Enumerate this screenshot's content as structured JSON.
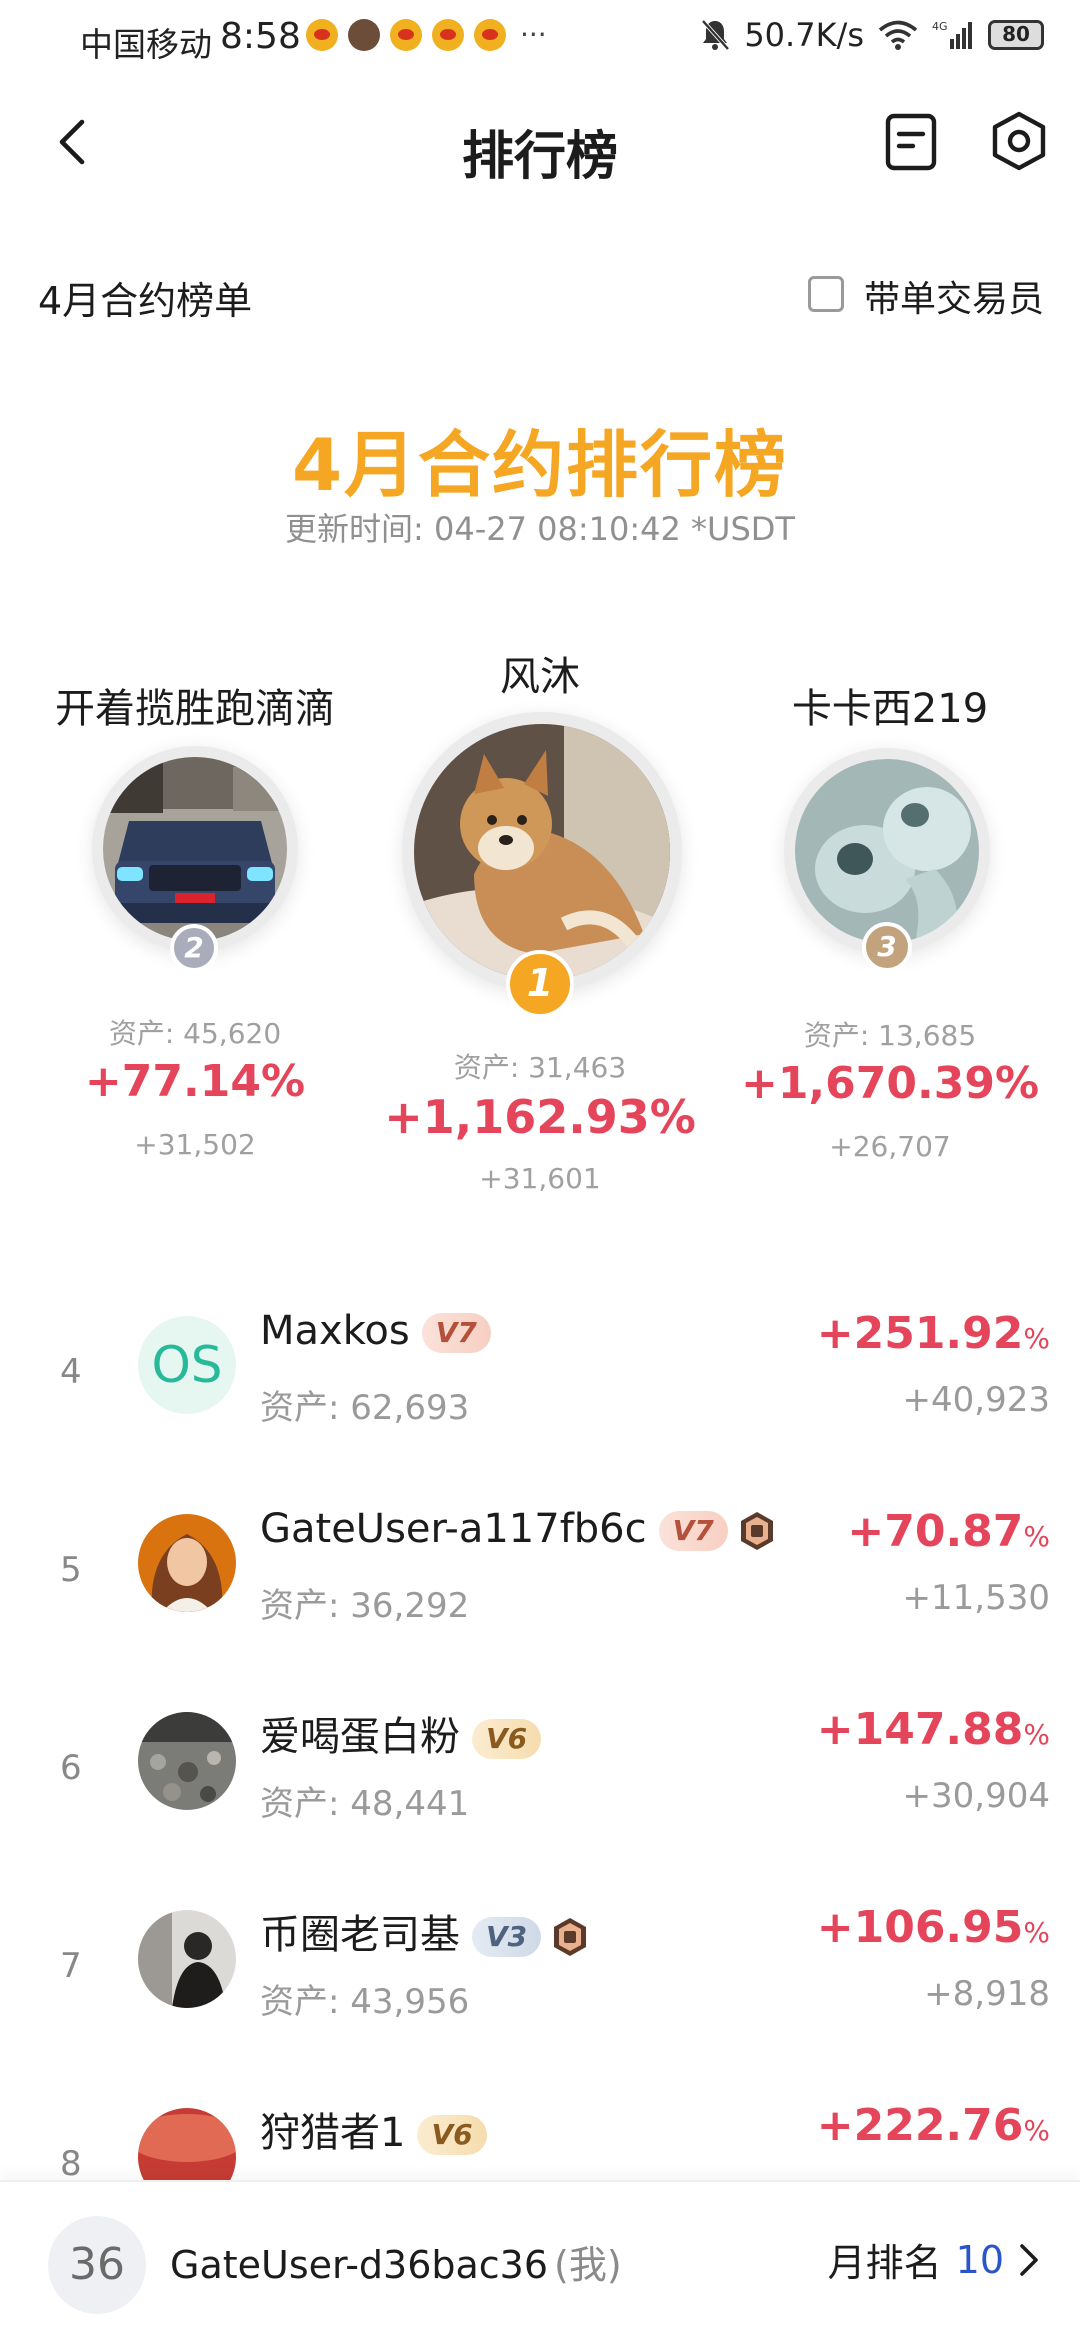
{
  "status_bar": {
    "carrier": "中国移动",
    "time": "8:58",
    "more": "···",
    "net_speed": "50.7K/s",
    "network": "4G",
    "battery": "80"
  },
  "header": {
    "title": "排行榜"
  },
  "filter": {
    "title": "4月合约榜单",
    "checkbox_label": "带单交易员",
    "checked": false
  },
  "hero": {
    "title": "4月合约排行榜",
    "update_label": "更新时间:",
    "update_time": "04-27 08:10:42",
    "unit": "*USDT"
  },
  "podium": [
    {
      "rank": "1",
      "name": "风沐",
      "asset": "资产: 31,463",
      "pct": "+1,162.93%",
      "gain": "+31,601",
      "avatar": "shiba-dog-photo"
    },
    {
      "rank": "2",
      "name": "开着揽胜跑滴滴",
      "asset": "资产: 45,620",
      "pct": "+77.14%",
      "gain": "+31,502",
      "avatar": "range-rover-photo"
    },
    {
      "rank": "3",
      "name": "卡卡西219",
      "asset": "资产: 13,685",
      "pct": "+1,670.39%",
      "gain": "+26,707",
      "avatar": "earbuds-photo"
    }
  ],
  "list": [
    {
      "rank": "4",
      "name": "Maxkos",
      "vip": "V7",
      "medal": false,
      "asset": "资产: 62,693",
      "pct": "+251.92",
      "pct_sign": "%",
      "gain": "+40,923",
      "avatar_text": "OS"
    },
    {
      "rank": "5",
      "name": "GateUser-a117fb6c",
      "vip": "V7",
      "medal": true,
      "asset": "资产: 36,292",
      "pct": "+70.87",
      "pct_sign": "%",
      "gain": "+11,530"
    },
    {
      "rank": "6",
      "name": "爱喝蛋白粉",
      "vip": "V6",
      "medal": false,
      "asset": "资产: 48,441",
      "pct": "+147.88",
      "pct_sign": "%",
      "gain": "+30,904"
    },
    {
      "rank": "7",
      "name": "币圈老司基",
      "vip": "V3",
      "medal": true,
      "asset": "资产: 43,956",
      "pct": "+106.95",
      "pct_sign": "%",
      "gain": "+8,918"
    },
    {
      "rank": "8",
      "name": "狩猎者1",
      "vip": "V6",
      "medal": false,
      "asset": "",
      "pct": "+222.76",
      "pct_sign": "%",
      "gain": ""
    }
  ],
  "my_rank": {
    "rank": "36",
    "name": "GateUser-d36bac36",
    "tag": "(我)",
    "monthly_label": "月排名",
    "monthly_value": "10"
  },
  "colors": {
    "accent_gold": "#f5a623",
    "profit_red": "#e5455a",
    "link_blue": "#2a55c9",
    "silver": "#a9adbb",
    "bronze": "#c2a37e"
  }
}
